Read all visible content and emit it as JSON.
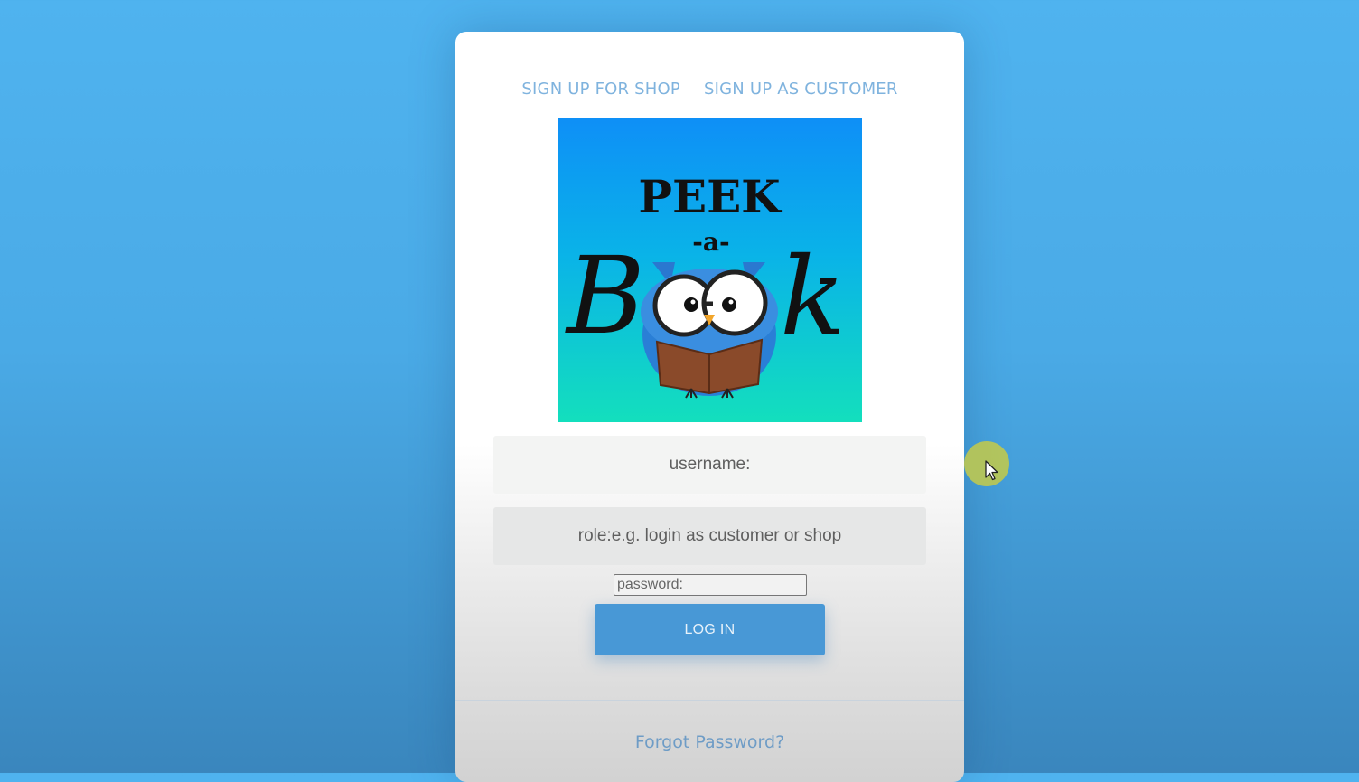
{
  "tabs": {
    "signup_shop": "SIGN UP FOR SHOP",
    "signup_customer": "SIGN UP AS CUSTOMER"
  },
  "logo": {
    "line1": "PEEK",
    "line2": "-a-",
    "b_letter": "B",
    "k_letter": "k"
  },
  "form": {
    "username_label": "username:",
    "role_label": "role:e.g. login as customer or shop",
    "password_placeholder": "password:",
    "login_label": "LOG IN"
  },
  "footer": {
    "forgot_label": "Forgot Password?"
  },
  "colors": {
    "accent": "#4898d6",
    "link": "#7fb3de",
    "background": "#4aaae6"
  }
}
